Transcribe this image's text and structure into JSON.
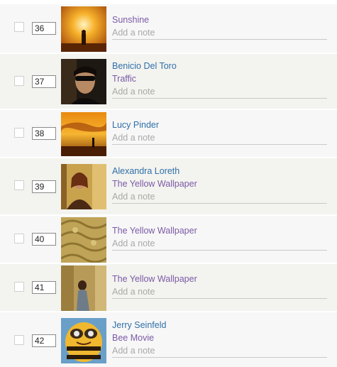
{
  "list": {
    "items": [
      {
        "position": "36",
        "person": "",
        "title": "Sunshine",
        "note_placeholder": "Add a note",
        "thumb_icon": "film-still-image"
      },
      {
        "position": "37",
        "person": "Benicio Del Toro",
        "title": "Traffic",
        "note_placeholder": "Add a note",
        "thumb_icon": "film-still-image"
      },
      {
        "position": "38",
        "person": "Lucy Pinder",
        "title": "",
        "note_placeholder": "Add a note",
        "thumb_icon": "film-still-image"
      },
      {
        "position": "39",
        "person": "Alexandra Loreth",
        "title": "The Yellow Wallpaper",
        "note_placeholder": "Add a note",
        "thumb_icon": "film-still-image"
      },
      {
        "position": "40",
        "person": "",
        "title": "The Yellow Wallpaper",
        "note_placeholder": "Add a note",
        "thumb_icon": "film-still-image"
      },
      {
        "position": "41",
        "person": "",
        "title": "The Yellow Wallpaper",
        "note_placeholder": "Add a note",
        "thumb_icon": "film-still-image"
      },
      {
        "position": "42",
        "person": "Jerry Seinfeld",
        "title": "Bee Movie",
        "note_placeholder": "Add a note",
        "thumb_icon": "film-still-image"
      }
    ]
  }
}
